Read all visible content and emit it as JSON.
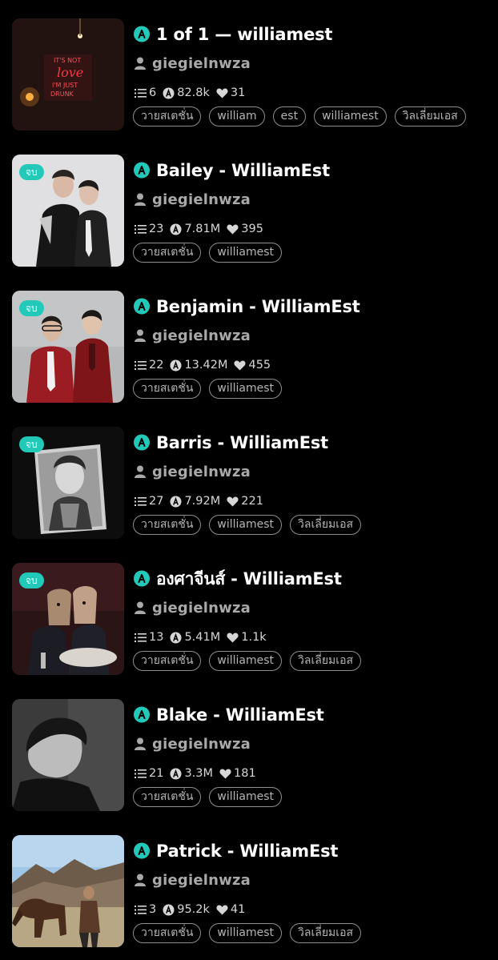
{
  "stories": [
    {
      "title": "1 of 1 — williamest",
      "author": "giegielnwza",
      "chapters": "6",
      "views": "82.8k",
      "likes": "31",
      "badge": "",
      "tags": [
        "วายสเตชั่น",
        "william",
        "est",
        "williamest",
        "วิลเลี่ยมเอส"
      ],
      "cover": "neon-sign"
    },
    {
      "title": "Bailey - WilliamEst",
      "author": "giegielnwza",
      "chapters": "23",
      "views": "7.81M",
      "likes": "395",
      "badge": "จบ",
      "tags": [
        "วายสเตชั่น",
        "williamest"
      ],
      "cover": "two-men-black-suits"
    },
    {
      "title": "Benjamin - WilliamEst",
      "author": "giegielnwza",
      "chapters": "22",
      "views": "13.42M",
      "likes": "455",
      "badge": "จบ",
      "tags": [
        "วายสเตชั่น",
        "williamest"
      ],
      "cover": "two-men-red-suits"
    },
    {
      "title": "Barris - WilliamEst",
      "author": "giegielnwza",
      "chapters": "27",
      "views": "7.92M",
      "likes": "221",
      "badge": "จบ",
      "tags": [
        "วายสเตชั่น",
        "williamest",
        "วิลเลี่ยมเอส"
      ],
      "cover": "bw-portrait-lightbox"
    },
    {
      "title": "องศาจีนส์ - WilliamEst",
      "author": "giegielnwza",
      "chapters": "13",
      "views": "5.41M",
      "likes": "1.1k",
      "badge": "จบ",
      "tags": [
        "วายสเตชั่น",
        "williamest",
        "วิลเลี่ยมเอส"
      ],
      "cover": "dinner-masks"
    },
    {
      "title": "Blake - WilliamEst",
      "author": "giegielnwza",
      "chapters": "21",
      "views": "3.3M",
      "likes": "181",
      "badge": "",
      "tags": [
        "วายสเตชั่น",
        "williamest"
      ],
      "cover": "bw-profile"
    },
    {
      "title": "Patrick - WilliamEst",
      "author": "giegielnwza",
      "chapters": "3",
      "views": "95.2k",
      "likes": "41",
      "badge": "",
      "tags": [
        "วายสเตชั่น",
        "williamest",
        "วิลเลี่ยมเอส"
      ],
      "cover": "man-with-horse"
    }
  ],
  "icons": {
    "paid": "paid-story-icon",
    "author": "user-icon",
    "chapters": "list-icon",
    "views": "read-count-icon",
    "likes": "heart-icon"
  },
  "colors": {
    "accent": "#23c9b8",
    "background": "#000000",
    "secondary_text": "#a9a9a9",
    "tag_border": "#8e8e8e"
  },
  "neon_sign": {
    "line1": "IT'S NOT",
    "line2": "love",
    "line3": "I'M JUST",
    "line4": "DRUNK"
  }
}
